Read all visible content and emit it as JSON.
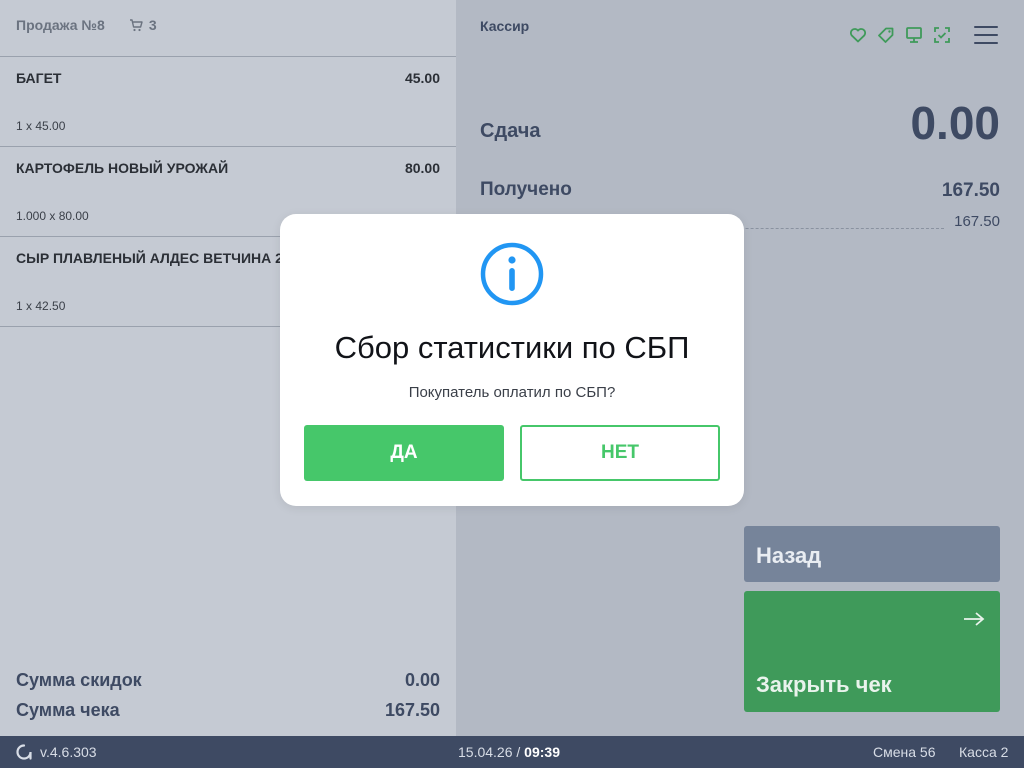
{
  "sale": {
    "title": "Продажа №8",
    "cart_count": "3",
    "items": [
      {
        "name": "БАГЕТ",
        "price": "45.00",
        "qty": "1 x 45.00"
      },
      {
        "name": "КАРТОФЕЛЬ НОВЫЙ УРОЖАЙ",
        "price": "80.00",
        "qty": "1.000 x 80.00"
      },
      {
        "name": "СЫР ПЛАВЛЕНЫЙ АЛДЕС ВЕТЧИНА 20",
        "price": "",
        "qty": "1 x 42.50"
      }
    ],
    "discount_label": "Сумма скидок",
    "discount_value": "0.00",
    "total_label": "Сумма чека",
    "total_value": "167.50"
  },
  "payment": {
    "cashier_label": "Кассир",
    "change_label": "Сдача",
    "change_value": "0.00",
    "received_label": "Получено",
    "received_value": "167.50",
    "received_sub": "167.50",
    "back_label": "Назад",
    "close_label": "Закрыть чек",
    "header_icons": [
      "heart-icon",
      "tag-icon",
      "monitor-icon",
      "scan-check-icon"
    ]
  },
  "footer": {
    "version": "v.4.6.303",
    "date": "15.04.26",
    "separator": " / ",
    "time": "09:39",
    "shift": "Смена 56",
    "register": "Касса 2"
  },
  "dialog": {
    "title": "Сбор статистики по СБП",
    "message": "Покупатель оплатил по СБП?",
    "yes_label": "ДА",
    "no_label": "НЕТ"
  },
  "colors": {
    "accent_green": "#46c76a",
    "info_blue": "#2196f3",
    "dark_navy": "#3e4a63"
  }
}
